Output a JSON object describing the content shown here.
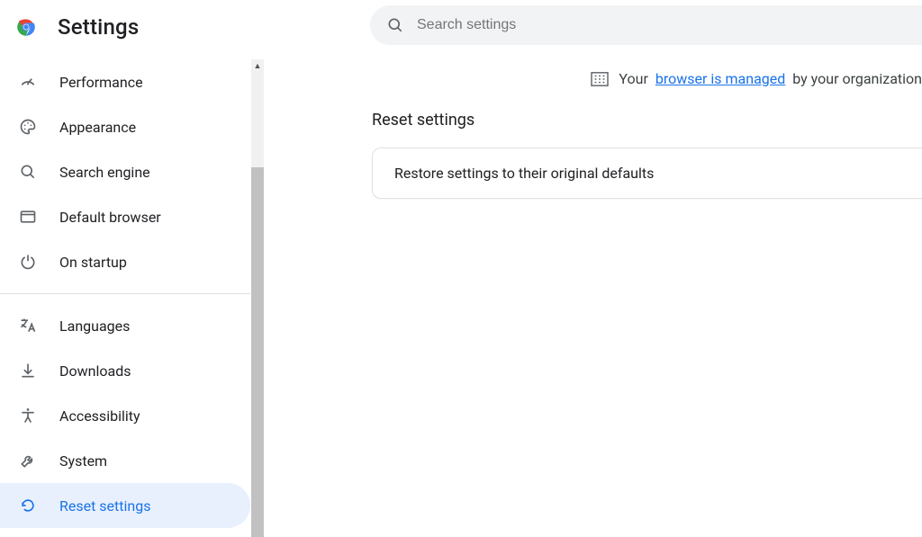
{
  "app": {
    "title": "Settings"
  },
  "search": {
    "placeholder": "Search settings"
  },
  "managed": {
    "prefix": "Your",
    "link": "browser is managed",
    "suffix": "by your organization"
  },
  "section": {
    "title": "Reset settings"
  },
  "card": {
    "restore": "Restore settings to their original defaults"
  },
  "nav": {
    "performance": "Performance",
    "appearance": "Appearance",
    "search_engine": "Search engine",
    "default_browser": "Default browser",
    "on_startup": "On startup",
    "languages": "Languages",
    "downloads": "Downloads",
    "accessibility": "Accessibility",
    "system": "System",
    "reset_settings": "Reset settings"
  }
}
